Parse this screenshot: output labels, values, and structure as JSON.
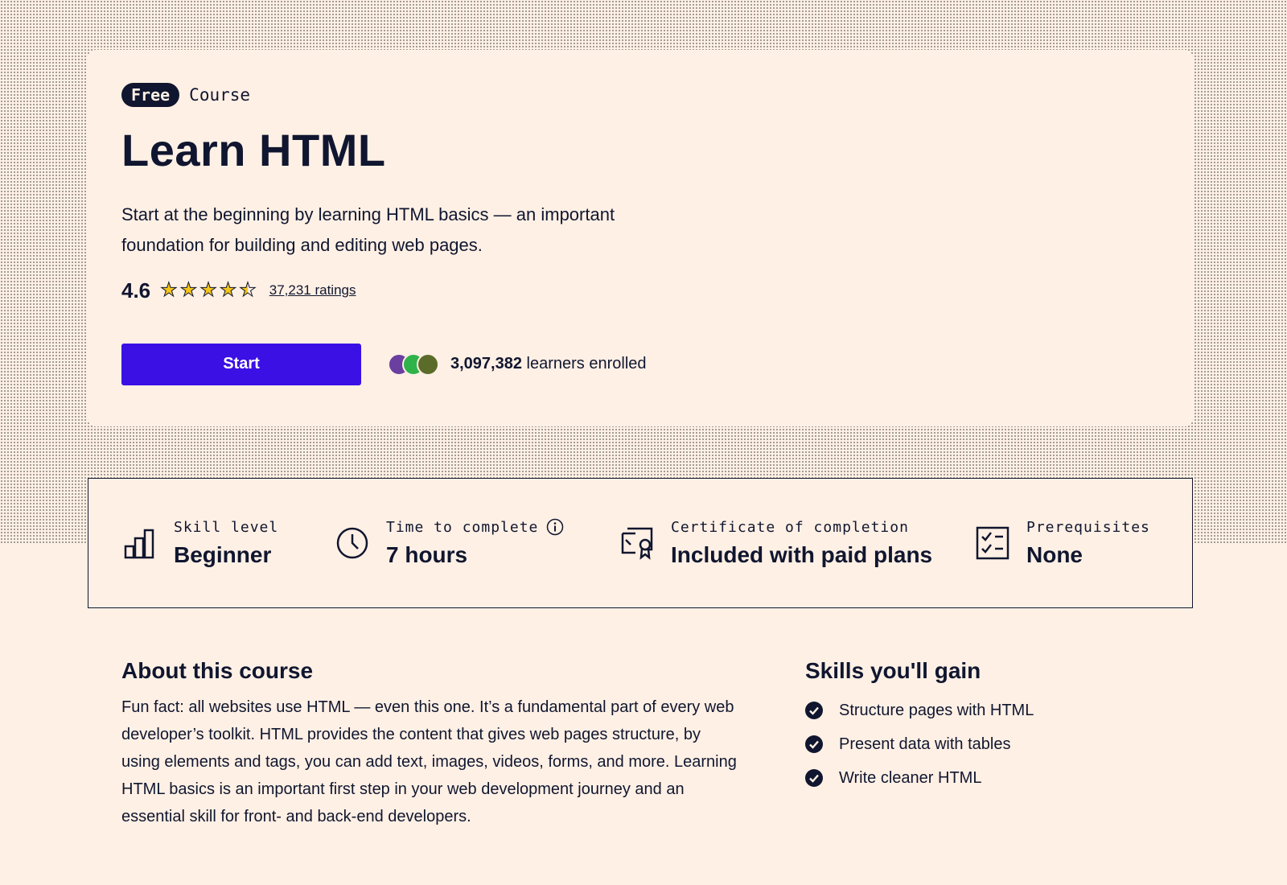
{
  "hero": {
    "badge": "Free",
    "kicker": "Course",
    "title": "Learn HTML",
    "description": "Start at the beginning by learning HTML basics — an important foundation for building and editing web pages.",
    "rating": "4.6",
    "rating_stars": 4.6,
    "ratings_link": "37,231 ratings",
    "start_label": "Start",
    "learners_count": "3,097,382",
    "learners_text": "learners enrolled"
  },
  "stats": [
    {
      "label": "Skill level",
      "value": "Beginner",
      "icon": "bar-chart-icon"
    },
    {
      "label": "Time to complete",
      "value": "7 hours",
      "icon": "clock-icon"
    },
    {
      "label": "Certificate of completion",
      "value": "Included with paid plans",
      "icon": "certificate-icon"
    },
    {
      "label": "Prerequisites",
      "value": "None",
      "icon": "checklist-icon"
    }
  ],
  "about": {
    "heading": "About this course",
    "body": "Fun fact: all websites use HTML — even this one. It’s a fundamental part of every web developer’s toolkit. HTML provides the content that gives web pages structure, by using elements and tags, you can add text, images, videos, forms, and more. Learning HTML basics is an important first step in your web development journey and an essential skill for front- and back-end developers."
  },
  "skills": {
    "heading": "Skills you'll gain",
    "items": [
      "Structure pages with HTML",
      "Present data with tables",
      "Write cleaner HTML"
    ]
  },
  "colors": {
    "background": "#fff0e5",
    "text": "#10162f",
    "accent": "#3a10e5",
    "star": "#f5c518"
  }
}
